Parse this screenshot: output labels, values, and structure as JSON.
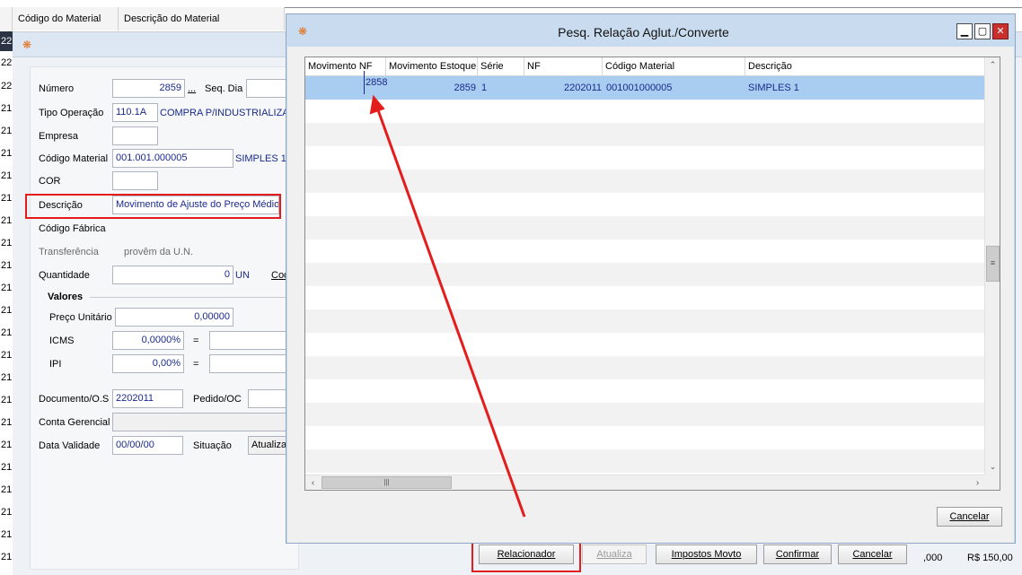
{
  "top_grid": {
    "columns": [
      "Código do Material",
      "Descrição do Material"
    ]
  },
  "row_numbers": [
    "22",
    "22",
    "22",
    "21",
    "21",
    "21",
    "21",
    "21",
    "21",
    "21",
    "21",
    "21",
    "21",
    "21",
    "21",
    "21",
    "21",
    "21",
    "21",
    "21",
    "21",
    "21",
    "21",
    "21"
  ],
  "form": {
    "numero_label": "Número",
    "numero_value": "2859",
    "numero_ellipsis": "...",
    "seq_dia_label": "Seq. Dia",
    "tipo_operacao_label": "Tipo Operação",
    "tipo_operacao_code": "110.1A",
    "tipo_operacao_desc": "COMPRA P/INDUSTRIALIZAC",
    "empresa_label": "Empresa",
    "codigo_material_label": "Código Material",
    "codigo_material_value": "001.001.000005",
    "codigo_material_desc": "SIMPLES 1",
    "cor_label": "COR",
    "descricao_label": "Descrição",
    "descricao_value": "Movimento de Ajuste do Preço Médio",
    "codigo_fabrica_label": "Código Fábrica",
    "transferencia_label": "Transferência",
    "transferencia_value": "provêm da U.N.",
    "quantidade_label": "Quantidade",
    "quantidade_value": "0",
    "quantidade_unit": "UN",
    "quantidade_extra": "Cod",
    "valores_title": "Valores",
    "preco_unitario_label": "Preço Unitário",
    "preco_unitario_value": "0,00000",
    "icms_label": "ICMS",
    "icms_value": "0,0000%",
    "icms_eq": "=",
    "ipi_label": "IPI",
    "ipi_value": "0,00%",
    "ipi_eq": "=",
    "documento_label": "Documento/O.S",
    "documento_value": "2202011",
    "pedido_label": "Pedido/OC",
    "conta_gerencial_label": "Conta Gerencial",
    "data_validade_label": "Data Validade",
    "data_validade_value": "00/00/00",
    "situacao_label": "Situação",
    "situacao_value": "Atualiza"
  },
  "bottom_buttons": {
    "relacionador": "Relacionador",
    "atualiza": "Atualiza",
    "impostos": "Impostos Movto",
    "confirmar": "Confirmar",
    "cancelar": "Cancelar"
  },
  "bottom_values": {
    "left": ",000",
    "right": "R$ 150,00"
  },
  "dialog": {
    "title": "Pesq. Relação Aglut./Converte",
    "columns": [
      "Movimento NF",
      "Movimento Estoque",
      "Série",
      "NF",
      "Código Material",
      "Descrição"
    ],
    "rows": [
      {
        "movimento_nf": "2858",
        "movimento_estoque": "2859",
        "serie": "1",
        "nf": "2202011",
        "codigo_material": "001001000005",
        "descricao": "SIMPLES 1"
      }
    ],
    "cancel_label": "Cancelar"
  },
  "colors": {
    "highlight": "#e41c1c",
    "selected_row": "#a8cdf0",
    "value_text": "#1a2a8c"
  }
}
